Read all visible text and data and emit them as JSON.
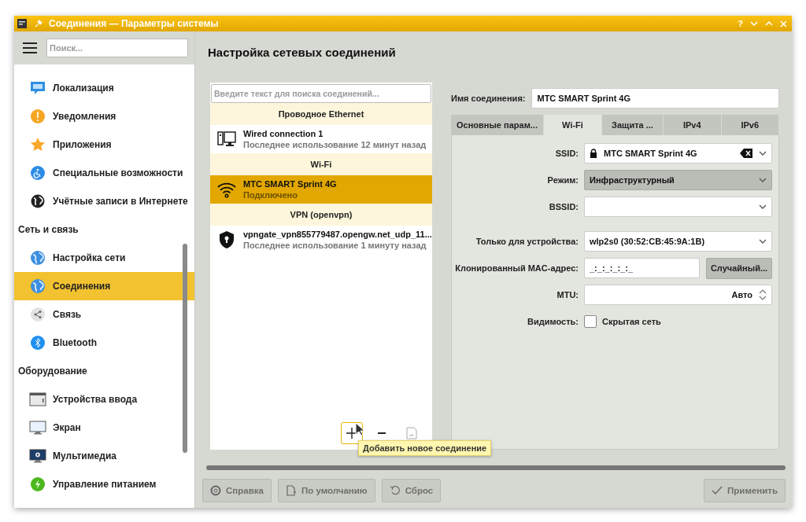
{
  "window": {
    "title": "Соединения — Параметры системы",
    "help": "?"
  },
  "sidebar": {
    "search_placeholder": "Поиск...",
    "items": [
      {
        "kind": "item",
        "label": "Локализация",
        "selected": false
      },
      {
        "kind": "item",
        "label": "Уведомления",
        "selected": false
      },
      {
        "kind": "item",
        "label": "Приложения",
        "selected": false
      },
      {
        "kind": "item",
        "label": "Специальные возможности",
        "selected": false
      },
      {
        "kind": "item",
        "label": "Учётные записи в Интернете",
        "selected": false
      },
      {
        "kind": "header",
        "label": "Сеть и связь"
      },
      {
        "kind": "item",
        "label": "Настройка сети",
        "selected": false
      },
      {
        "kind": "item",
        "label": "Соединения",
        "selected": true
      },
      {
        "kind": "item",
        "label": "Связь",
        "selected": false
      },
      {
        "kind": "item",
        "label": "Bluetooth",
        "selected": false
      },
      {
        "kind": "header",
        "label": "Оборудование"
      },
      {
        "kind": "item",
        "label": "Устройства ввода",
        "selected": false
      },
      {
        "kind": "item",
        "label": "Экран",
        "selected": false
      },
      {
        "kind": "item",
        "label": "Мультимедиа",
        "selected": false
      },
      {
        "kind": "item",
        "label": "Управление питанием",
        "selected": false
      }
    ]
  },
  "heading": "Настройка сетевых соединений",
  "connections": {
    "search_placeholder": "Введите текст для поиска соединений...",
    "groups": [
      {
        "title": "Проводное Ethernet",
        "items": [
          {
            "name": "Wired connection 1",
            "status": "Последнее использование 12 минут назад",
            "selected": false
          }
        ]
      },
      {
        "title": "Wi-Fi",
        "items": [
          {
            "name": "MTC SMART Sprint 4G",
            "status": "Подключено",
            "selected": true
          }
        ]
      },
      {
        "title": "VPN (openvpn)",
        "items": [
          {
            "name": "vpngate_vpn855779487.opengw.net_udp_11...",
            "status": "Последнее использование 1 минуту назад",
            "selected": false
          }
        ]
      }
    ],
    "tooltip": "Добавить новое соединение"
  },
  "details": {
    "name_label": "Имя соединения:",
    "name_value": "MTC SMART Sprint 4G",
    "tabs": [
      {
        "label": "Основные парам...",
        "selected": false
      },
      {
        "label": "Wi-Fi",
        "selected": true
      },
      {
        "label": "Защита ...",
        "selected": false
      },
      {
        "label": "IPv4",
        "selected": false
      },
      {
        "label": "IPv6",
        "selected": false
      }
    ],
    "sections": [
      [
        {
          "kind": "combo",
          "label": "SSID:",
          "value": "MTC SMART Sprint 4G",
          "locked": true
        },
        {
          "kind": "select",
          "label": "Режим:",
          "value": "Инфраструктурный"
        },
        {
          "kind": "combo",
          "label": "BSSID:"
        }
      ],
      [
        {
          "kind": "combo",
          "label": "Только для устройства:",
          "value": "wlp2s0 (30:52:CB:45:9A:1B)"
        },
        {
          "kind": "mac",
          "label": "Клонированный MAC-адрес:",
          "value": "_:_:_:_:_:_",
          "button": "Случайный..."
        },
        {
          "kind": "spin",
          "label": "MTU:",
          "value": "Авто"
        },
        {
          "kind": "checkbox",
          "label": "Видимость:",
          "text": "Скрытая сеть",
          "checked": false
        }
      ]
    ]
  },
  "footer": {
    "buttons": [
      {
        "label": "Справка",
        "disabled": true
      },
      {
        "label": "По умолчанию",
        "disabled": true
      },
      {
        "label": "Сброс",
        "disabled": true
      },
      {
        "label": "Применить",
        "disabled": true
      }
    ]
  }
}
